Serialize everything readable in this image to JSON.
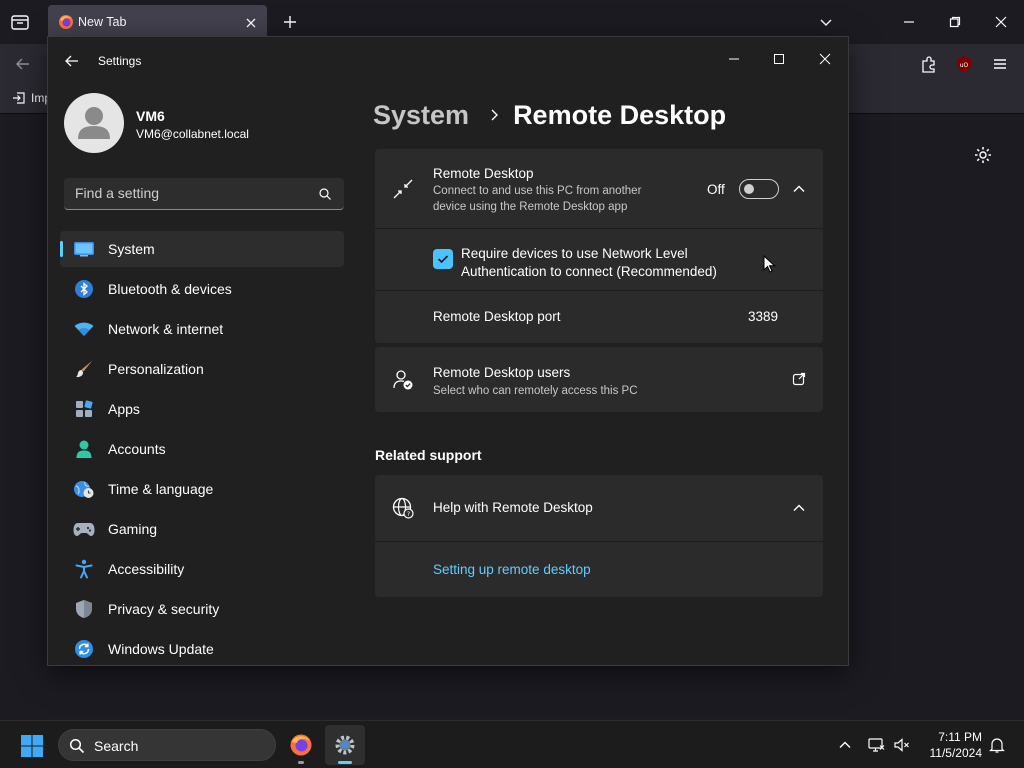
{
  "browser": {
    "tab_title": "New Tab",
    "bookmark_import": "Imp"
  },
  "settings": {
    "window_title": "Settings",
    "profile": {
      "name": "VM6",
      "email": "VM6@collabnet.local"
    },
    "search": {
      "placeholder": "Find a setting"
    },
    "nav": [
      {
        "label": "System",
        "icon": "system-monitor-icon",
        "active": true
      },
      {
        "label": "Bluetooth & devices",
        "icon": "bluetooth-icon"
      },
      {
        "label": "Network & internet",
        "icon": "wifi-icon"
      },
      {
        "label": "Personalization",
        "icon": "paintbrush-icon"
      },
      {
        "label": "Apps",
        "icon": "apps-icon"
      },
      {
        "label": "Accounts",
        "icon": "accounts-icon"
      },
      {
        "label": "Time & language",
        "icon": "globe-clock-icon"
      },
      {
        "label": "Gaming",
        "icon": "gamepad-icon"
      },
      {
        "label": "Accessibility",
        "icon": "accessibility-icon"
      },
      {
        "label": "Privacy & security",
        "icon": "shield-icon"
      },
      {
        "label": "Windows Update",
        "icon": "update-icon"
      }
    ],
    "breadcrumb": {
      "parent": "System",
      "current": "Remote Desktop"
    },
    "remote_desktop": {
      "title": "Remote Desktop",
      "description": "Connect to and use this PC from another device using the Remote Desktop app",
      "toggle_label": "Off",
      "toggle_on": false,
      "nla_label": "Require devices to use Network Level Authentication to connect (Recommended)",
      "nla_checked": true,
      "port_label": "Remote Desktop port",
      "port_value": "3389"
    },
    "users": {
      "title": "Remote Desktop users",
      "description": "Select who can remotely access this PC"
    },
    "related_support": {
      "title": "Related support",
      "help_title": "Help with Remote Desktop",
      "link": "Setting up remote desktop"
    }
  },
  "taskbar": {
    "search_label": "Search",
    "time": "7:11 PM",
    "date": "11/5/2024"
  },
  "colors": {
    "accent": "#60cdff",
    "checkbox": "#4cc2ff",
    "window_bg": "#202020",
    "card_bg": "#2b2b2b"
  }
}
